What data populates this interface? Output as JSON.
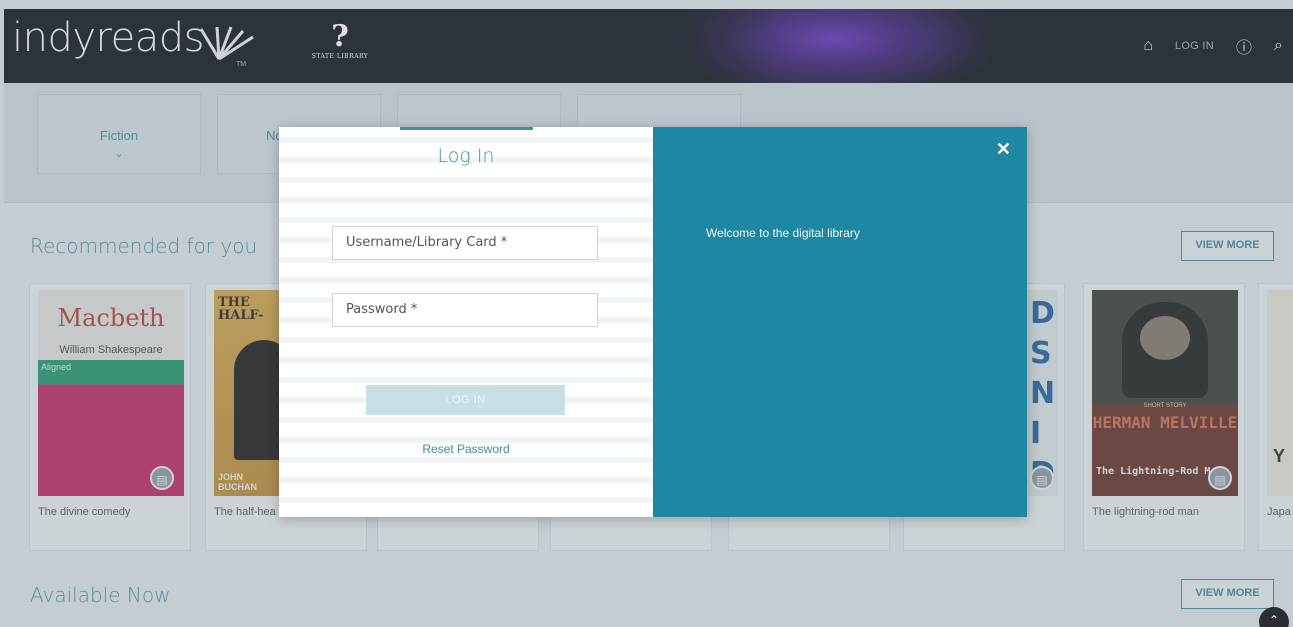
{
  "header": {
    "logo_text": "indyreads",
    "logo_tm": "TM",
    "partner_mark": "?",
    "partner_text": "STATE LIBRARY",
    "login_label": "LOG IN",
    "home_icon": "home-icon",
    "help_icon": "help-circle-icon",
    "search_icon": "search-icon"
  },
  "categories": [
    {
      "label": "Fiction"
    },
    {
      "label": "No"
    },
    {
      "label": ""
    },
    {
      "label": ""
    }
  ],
  "sections": {
    "recommended": {
      "title": "Recommended for you",
      "view_more": "VIEW MORE"
    },
    "available": {
      "title": "Available Now",
      "view_more": "VIEW MORE"
    }
  },
  "books": [
    {
      "title": "The divine comedy",
      "cover_title": "Macbeth",
      "cover_author": "William Shakespeare",
      "cover_tag": "Aligned"
    },
    {
      "title": "The half-hea",
      "cover_title": "THE HALF-",
      "cover_author": "JOHN BUCHAN"
    },
    {
      "title": "",
      "cover_title": ""
    },
    {
      "title": "",
      "cover_title": ""
    },
    {
      "title": "",
      "cover_title": ""
    },
    {
      "title": "",
      "cover_title": "DS N ID IC"
    },
    {
      "title": "The lightning-rod man",
      "cover_title": "HERMAN MELVILLE",
      "cover_sub": "The Lightning-Rod M",
      "cover_top": "SHORT STORY"
    },
    {
      "title": "Japa",
      "cover_title": "Y"
    }
  ],
  "modal": {
    "tab_title": "Log In",
    "username_placeholder": "Username/Library Card *",
    "password_placeholder": "Password *",
    "login_button": "LOG IN",
    "reset_link": "Reset Password",
    "welcome_text": "Welcome to the digital library",
    "close_icon": "close-icon"
  },
  "colors": {
    "accent": "#3b95a8",
    "modal_panel": "#1e88a3"
  }
}
